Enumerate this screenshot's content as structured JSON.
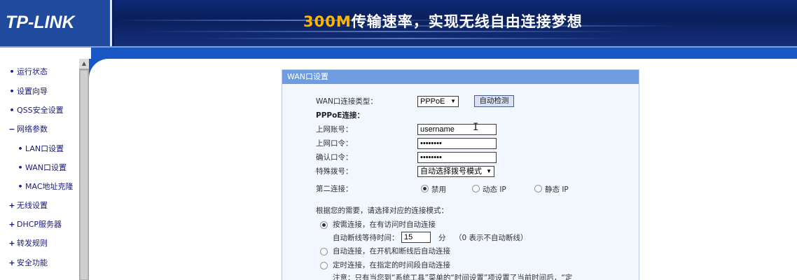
{
  "header": {
    "logo": "TP-LINK",
    "slogan_highlight": "300M",
    "slogan_rest": "传输速率，实现无线自由连接梦想"
  },
  "sidebar": {
    "items": [
      {
        "bullet": "•",
        "label": "运行状态"
      },
      {
        "bullet": "•",
        "label": "设置向导"
      },
      {
        "bullet": "•",
        "label": "QSS安全设置"
      },
      {
        "bullet": "−",
        "label": "网络参数"
      },
      {
        "bullet": "•",
        "label": "LAN口设置"
      },
      {
        "bullet": "•",
        "label": "WAN口设置"
      },
      {
        "bullet": "•",
        "label": "MAC地址克隆"
      },
      {
        "bullet": "+",
        "label": "无线设置"
      },
      {
        "bullet": "+",
        "label": "DHCP服务器"
      },
      {
        "bullet": "+",
        "label": "转发规则"
      },
      {
        "bullet": "+",
        "label": "安全功能"
      }
    ]
  },
  "panel": {
    "title": "WAN口设置",
    "wan_type_label": "WAN口连接类型：",
    "wan_type_value": "PPPoE",
    "auto_detect_button": "自动检测",
    "pppoe_section": "PPPoE连接：",
    "account_label": "上网账号：",
    "account_value": "username",
    "password_label": "上网口令：",
    "password_value": "••••••••",
    "confirm_label": "确认口令：",
    "confirm_value": "••••••••",
    "dial_label": "特殊拨号：",
    "dial_value": "自动选择拨号模式",
    "second_conn_label": "第二连接：",
    "second_options": [
      "禁用",
      "动态 IP",
      "静态 IP"
    ],
    "mode_prompt": "根据您的需要，请选择对应的连接模式：",
    "mode_on_demand": "按需连接，在有访问时自动连接",
    "idle_label": "自动断线等待时间：",
    "idle_value": "15",
    "idle_unit": "分",
    "idle_hint": "（0 表示不自动断线）",
    "mode_auto": "自动连接，在开机和断线后自动连接",
    "mode_timed": "定时连接，在指定的时间段自动连接",
    "note_partial": "注意：只有当您到“系统工具”菜单的“时间设置”项设置了当前时间后，“定"
  }
}
